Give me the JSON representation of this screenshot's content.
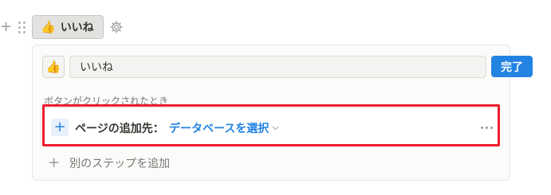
{
  "top_button": {
    "emoji": "👍",
    "label": "いいね"
  },
  "panel": {
    "emoji": "👍",
    "name_value": "いいね",
    "done_label": "完了",
    "trigger_label": "ボタンがクリックされたとき",
    "step": {
      "text": "ページの追加先：",
      "select_label": "データベースを選択"
    },
    "add_step_label": "別のステップを追加"
  },
  "colors": {
    "accent": "#2383e2",
    "highlight": "#ee1c2e"
  },
  "icons": [
    "plus-icon",
    "drag-handle-icon",
    "gear-icon",
    "chevron-down-icon",
    "more-icon"
  ]
}
